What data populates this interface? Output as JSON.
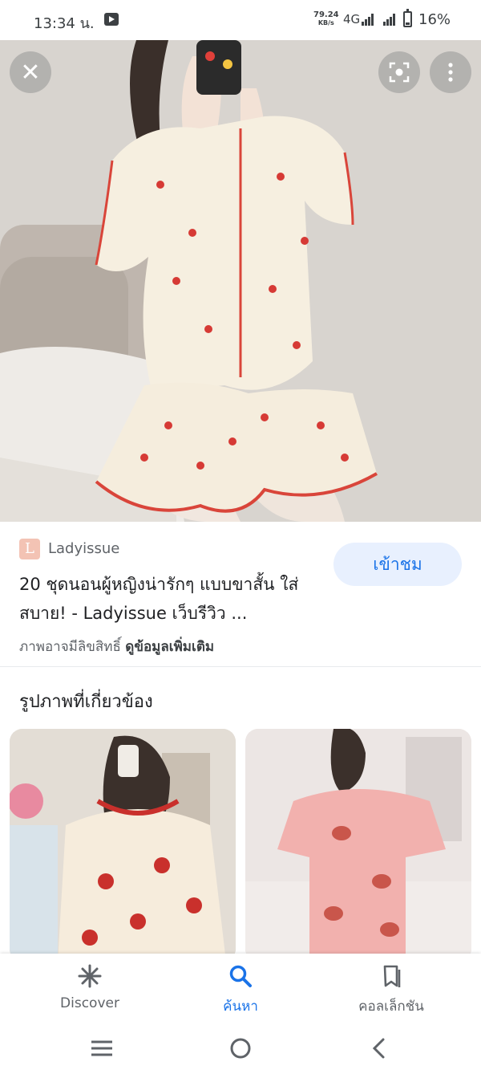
{
  "status_bar": {
    "time": "13:34 น.",
    "speed_value": "79.24",
    "speed_unit": "KB/s",
    "network": "4G",
    "battery": "16%"
  },
  "viewer": {
    "close_icon": "close-icon",
    "lens_icon": "lens-icon",
    "more_icon": "more-vert-icon"
  },
  "result": {
    "source_logo": "L",
    "source_name": "Ladyissue",
    "visit_label": "เข้าชม",
    "title": "20 ชุดนอนผู้หญิงน่ารักๆ แบบขาสั้น ใส่สบาย! - Ladyissue เว็บรีวิว ...",
    "copyright_text": "ภาพอาจมีลิขสิทธิ์",
    "more_info": "ดูข้อมูลเพิ่มเติม"
  },
  "related": {
    "heading": "รูปภาพที่เกี่ยวข้อง"
  },
  "bottom_nav": {
    "items": [
      {
        "label": "Discover",
        "icon": "asterisk-icon"
      },
      {
        "label": "ค้นหา",
        "icon": "search-icon"
      },
      {
        "label": "คอลเล็กชัน",
        "icon": "bookmarks-icon"
      }
    ]
  },
  "colors": {
    "accent": "#1a73e8",
    "visit_button_bg": "#e8f0fe",
    "text_primary": "#202124",
    "text_secondary": "#5f6368"
  }
}
